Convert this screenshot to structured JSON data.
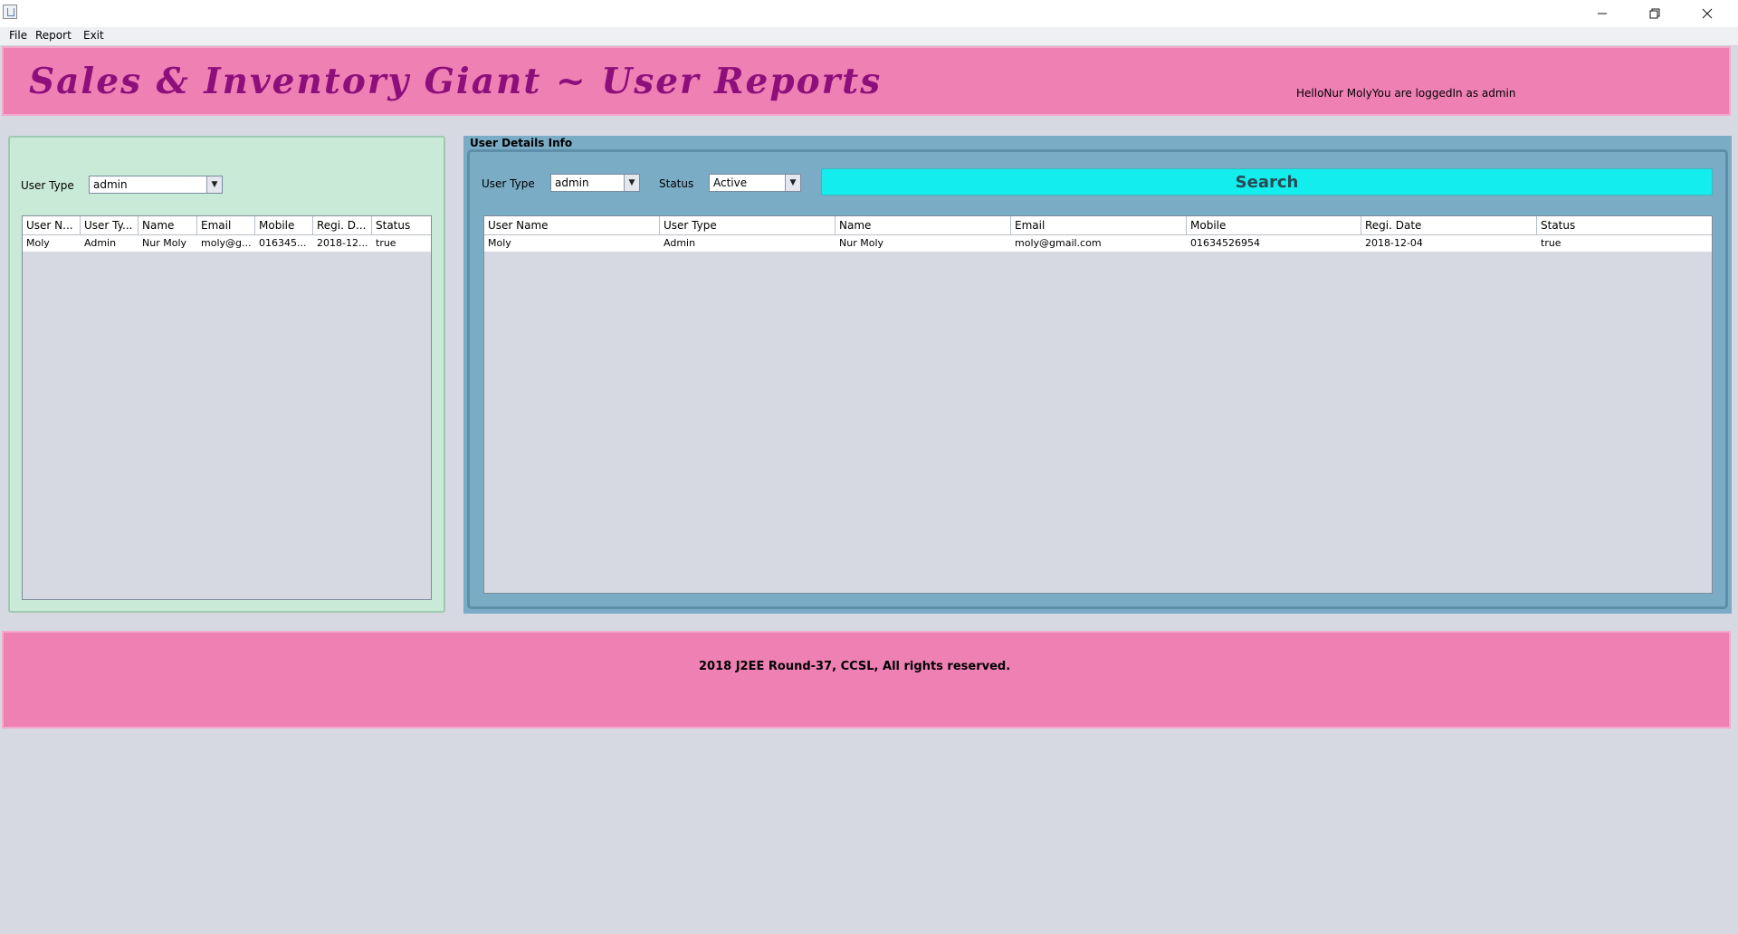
{
  "window": {
    "controls": {
      "minimize_icon": "minimize-icon",
      "maximize_icon": "restore-icon",
      "close_icon": "close-icon"
    }
  },
  "menu": [
    "File",
    "Report",
    "Exit"
  ],
  "header": {
    "title": "Sales & Inventory Giant ~ User Reports",
    "login_message": "HelloNur MolyYou are loggedIn as admin"
  },
  "left": {
    "user_type_label": "User Type",
    "user_type_value": "admin",
    "columns": [
      "User N...",
      "User Ty...",
      "Name",
      "Email",
      "Mobile",
      "Regi. D...",
      "Status"
    ],
    "rows": [
      [
        "Moly",
        "Admin",
        "Nur Moly",
        "moly@g...",
        "016345...",
        "2018-12...",
        "true"
      ]
    ]
  },
  "right": {
    "title": "User Details Info",
    "user_type_label": "User Type",
    "user_type_value": "admin",
    "status_label": "Status",
    "status_value": "Active",
    "search_label": "Search",
    "columns": [
      "User Name",
      "User Type",
      "Name",
      "Email",
      "Mobile",
      "Regi. Date",
      "Status"
    ],
    "rows": [
      [
        "Moly",
        "Admin",
        "Nur Moly",
        "moly@gmail.com",
        "01634526954",
        "2018-12-04",
        "true"
      ]
    ]
  },
  "footer": {
    "text": "2018 J2EE Round-37, CCSL, All rights reserved."
  },
  "colors": {
    "header_bg": "#ee80b4",
    "title_color": "#8d0f7c",
    "left_panel_bg": "#c8ead6",
    "right_panel_bg": "#7aacc5",
    "search_bg": "#13eded"
  }
}
